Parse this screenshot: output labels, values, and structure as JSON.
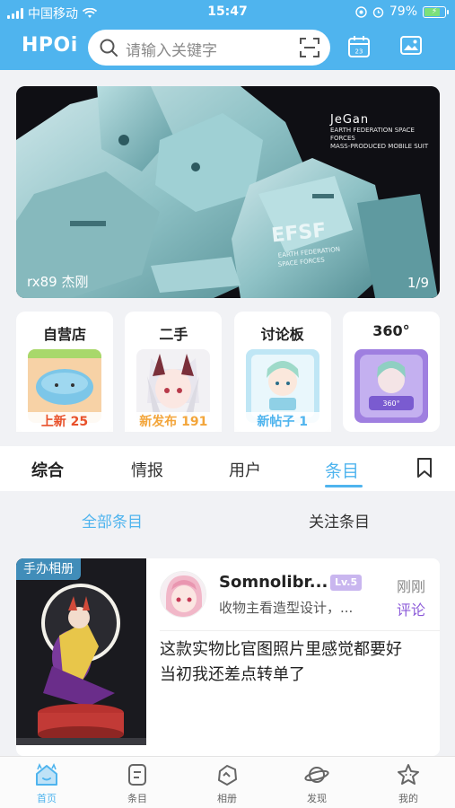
{
  "status_bar": {
    "carrier": "中国移动",
    "time": "15:47",
    "battery": "79%"
  },
  "header": {
    "logo": "HPOi",
    "search_placeholder": "请输入关键字"
  },
  "banner": {
    "caption": "rx89 杰刚",
    "page_indicator": "1/9",
    "logo_title": "JeGan",
    "logo_lines": [
      "EARTH FEDERATION SPACE FORCES",
      "MASS-PRODUCED MOBILE SUIT"
    ]
  },
  "cards": [
    {
      "title": "自营店",
      "badge": "上新 25",
      "badge_color": "#e8502a"
    },
    {
      "title": "二手",
      "badge": "新发布 191",
      "badge_color": "#f3a53a"
    },
    {
      "title": "讨论板",
      "badge": "新帖子 1",
      "badge_color": "#4fb4ee"
    },
    {
      "title": "360°",
      "badge": "",
      "badge_color": "#8c5bd9"
    }
  ],
  "tabs": [
    "综合",
    "情报",
    "用户",
    "条目"
  ],
  "active_tab": "条目",
  "subtabs": [
    "全部条目",
    "关注条目"
  ],
  "post": {
    "tag": "手办相册",
    "username": "Somnolibr...",
    "level": "Lv.5",
    "time": "刚刚",
    "description": "收物主看造型设计，...",
    "comment_label": "评论",
    "comment": "这款实物比官图照片里感觉都要好 当初我还差点转单了"
  },
  "bottom_nav": [
    "首页",
    "条目",
    "相册",
    "发现",
    "我的"
  ],
  "colors": {
    "primary": "#4fb4ee",
    "purple": "#8c5bd9",
    "background": "#f1f2f5"
  }
}
